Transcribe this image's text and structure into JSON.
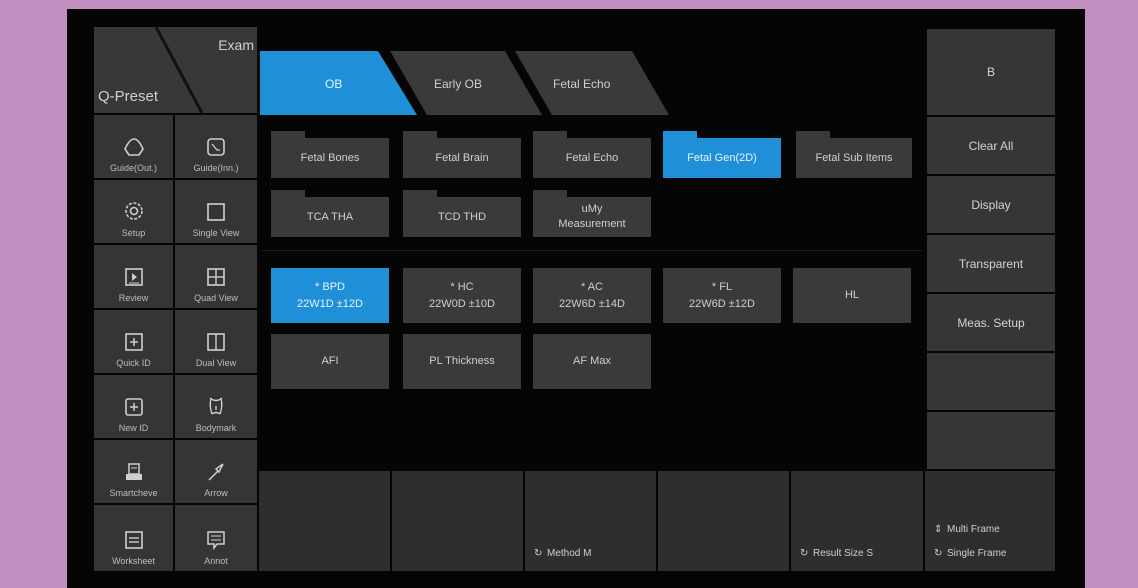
{
  "left_panel": {
    "preset_label": "Q-Preset",
    "exam_label": "Exam",
    "buttons": [
      {
        "label": "Guide(Out.)",
        "icon": "probe-icon"
      },
      {
        "label": "Guide(Inn.)",
        "icon": "inner-guide-icon"
      },
      {
        "label": "Setup",
        "icon": "gear-icon"
      },
      {
        "label": "Single View",
        "icon": "single-view-icon"
      },
      {
        "label": "Review",
        "icon": "review-icon"
      },
      {
        "label": "Quad View",
        "icon": "quad-view-icon"
      },
      {
        "label": "Quick ID",
        "icon": "quick-id-icon"
      },
      {
        "label": "Dual View",
        "icon": "dual-view-icon"
      },
      {
        "label": "New ID",
        "icon": "new-id-icon"
      },
      {
        "label": "Bodymark",
        "icon": "bodymark-icon"
      },
      {
        "label": "Smartcheve",
        "icon": "archive-icon"
      },
      {
        "label": "Arrow",
        "icon": "arrow-icon"
      },
      {
        "label": "Worksheet",
        "icon": "worksheet-icon"
      },
      {
        "label": "Annot",
        "icon": "annotation-icon"
      }
    ]
  },
  "exam_tabs": [
    {
      "label": "OB",
      "active": true
    },
    {
      "label": "Early OB",
      "active": false
    },
    {
      "label": "Fetal Echo",
      "active": false
    }
  ],
  "folders": [
    {
      "label": "Fetal Bones",
      "selected": false
    },
    {
      "label": "Fetal Brain",
      "selected": false
    },
    {
      "label": "Fetal Echo",
      "selected": false
    },
    {
      "label": "Fetal Gen(2D)",
      "selected": true
    },
    {
      "label": "Fetal Sub Items",
      "selected": false
    },
    {
      "label": "TCA THA",
      "selected": false
    },
    {
      "label": "TCD THD",
      "selected": false
    },
    {
      "label": "uMy Measurement",
      "line1": "uMy",
      "line2": "Measurement",
      "selected": false
    }
  ],
  "measurements": [
    {
      "name": "* BPD",
      "value": "22W1D ±12D",
      "selected": true
    },
    {
      "name": "* HC",
      "value": "22W0D ±10D",
      "selected": false
    },
    {
      "name": "* AC",
      "value": "22W6D ±14D",
      "selected": false
    },
    {
      "name": "* FL",
      "value": "22W6D ±12D",
      "selected": false
    },
    {
      "name": "HL",
      "value": "",
      "selected": false
    },
    {
      "name": "AFI",
      "value": "",
      "selected": false
    },
    {
      "name": "PL Thickness",
      "value": "",
      "selected": false
    },
    {
      "name": "AF Max",
      "value": "",
      "selected": false
    }
  ],
  "right_panel": {
    "buttons": [
      "B",
      "Clear All",
      "Display",
      "Transparent",
      "Meas. Setup",
      "",
      ""
    ]
  },
  "bottom_bar": {
    "method": "Method M",
    "result_size": "Result Size S",
    "multi_frame": "Multi Frame",
    "single_frame": "Single Frame"
  },
  "colors": {
    "accent": "#1f8fd8",
    "tile": "#3a3a3a",
    "background": "#050505",
    "frame": "#c08fc0"
  }
}
